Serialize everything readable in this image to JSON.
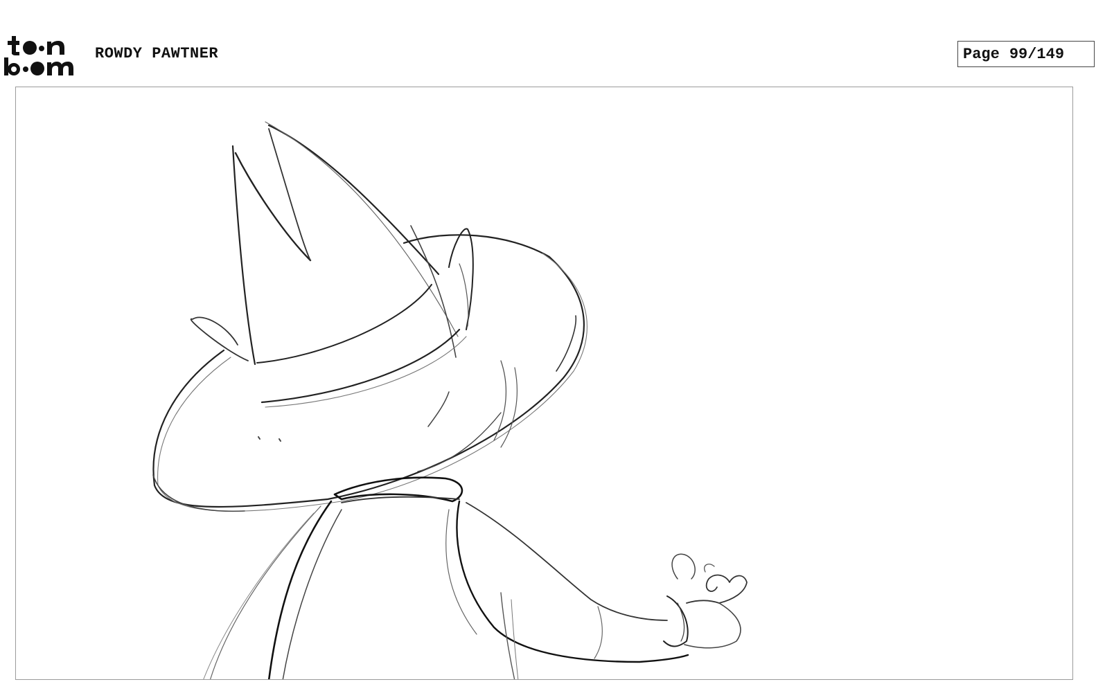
{
  "header": {
    "logo_text": "toon boom",
    "project_title": "ROWDY PAWTNER",
    "page_label": "Page",
    "page_number": "99/149"
  },
  "panel": {
    "drawing_icon": "sketch-cowboy-hat-character"
  }
}
